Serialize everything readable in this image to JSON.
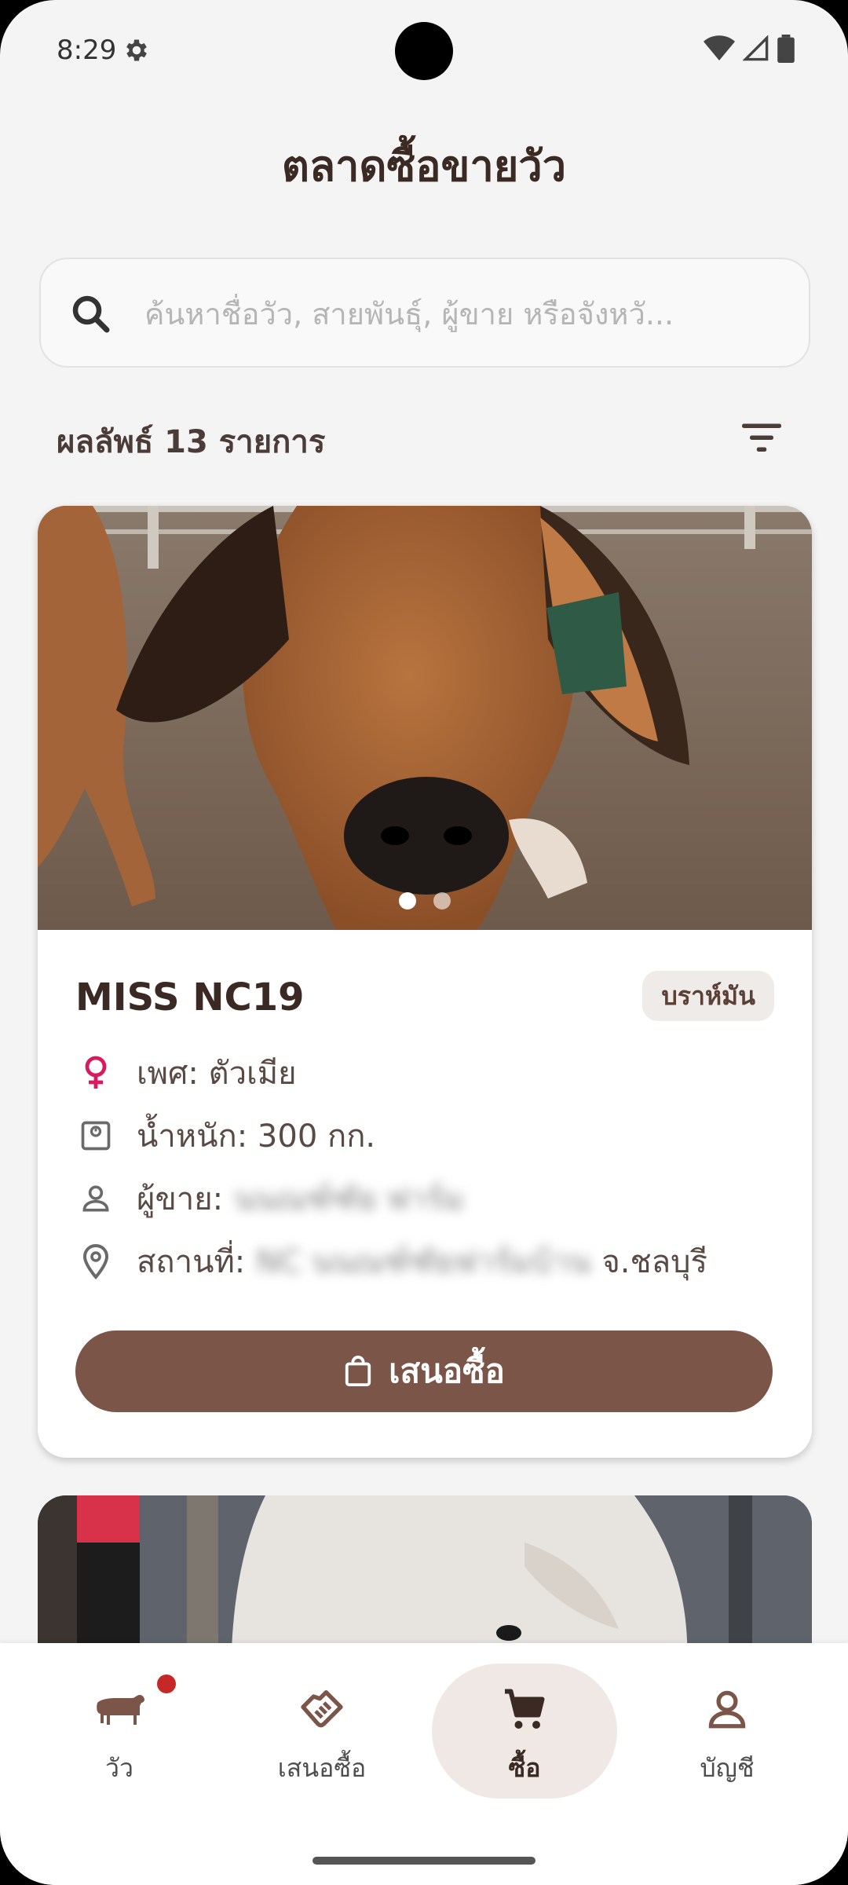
{
  "status_bar": {
    "time": "8:29"
  },
  "header": {
    "title": "ตลาดซื้อขายวัว"
  },
  "search": {
    "placeholder": "ค้นหาชื่อวัว, สายพันธุ์, ผู้ขาย หรือจังหวั..."
  },
  "results": {
    "label": "ผลลัพธ์ 13 รายการ"
  },
  "listing": {
    "name": "MISS NC19",
    "breed": "บราห์มัน",
    "gender": "เพศ: ตัวเมีย",
    "weight": "น้ำหนัก: 300 กก.",
    "seller_label": "ผู้ขาย:",
    "seller_name": "นนณฑ์ฑัย ฟาร์ม",
    "location_label": "สถานที่:",
    "location_blurred": "NC นนณฑ์ฑัยฟาร์มบ้าน",
    "province": "จ.ชลบุรี",
    "offer_label": "เสนอซื้อ",
    "image_count": 2,
    "active_image": 1
  },
  "nav": {
    "items": [
      {
        "label": "วัว",
        "icon": "cow-icon",
        "active": false
      },
      {
        "label": "เสนอซื้อ",
        "icon": "handshake-icon",
        "active": false
      },
      {
        "label": "ซื้อ",
        "icon": "cart-icon",
        "active": true
      },
      {
        "label": "บัญชี",
        "icon": "person-icon",
        "active": false
      }
    ]
  },
  "colors": {
    "primary": "#7b5548",
    "title": "#3b2a24",
    "female_icon": "#d81b60",
    "notification": "#c62828"
  }
}
